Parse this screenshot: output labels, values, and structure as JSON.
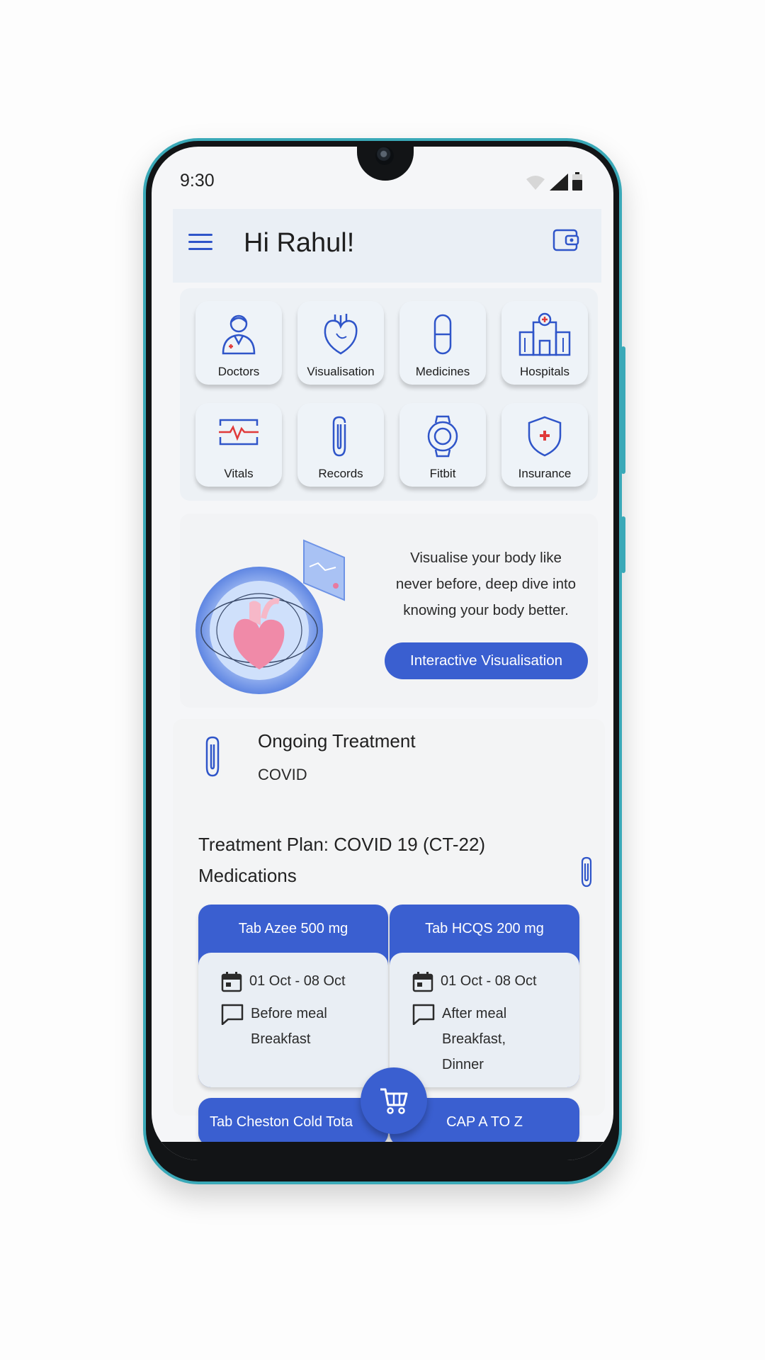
{
  "status_bar": {
    "time": "9:30"
  },
  "header": {
    "greeting": "Hi Rahul!"
  },
  "tiles": [
    {
      "label": "Doctors",
      "icon": "doctor-icon"
    },
    {
      "label": "Visualisation",
      "icon": "heart-anatomy-icon"
    },
    {
      "label": "Medicines",
      "icon": "pill-capsule-icon"
    },
    {
      "label": "Hospitals",
      "icon": "hospital-icon"
    },
    {
      "label": "Vitals",
      "icon": "vitals-monitor-icon"
    },
    {
      "label": "Records",
      "icon": "paperclip-icon"
    },
    {
      "label": "Fitbit",
      "icon": "smartwatch-icon"
    },
    {
      "label": "Insurance",
      "icon": "shield-plus-icon"
    }
  ],
  "visualise": {
    "line1": "Visualise your body like",
    "line2": "never before, deep dive into",
    "line3": "knowing your body better.",
    "button": "Interactive Visualisation"
  },
  "treatment": {
    "title": "Ongoing Treatment",
    "condition": "COVID",
    "plan": "Treatment Plan: COVID 19 (CT-22)",
    "medications_label": "Medications"
  },
  "medications": [
    {
      "name": "Tab Azee 500 mg",
      "dates": "01 Oct - 08 Oct",
      "instr1": "Before meal",
      "instr2": "Breakfast",
      "instr3": ""
    },
    {
      "name": "Tab HCQS 200 mg",
      "dates": "01 Oct - 08 Oct",
      "instr1": "After meal",
      "instr2": "Breakfast,",
      "instr3": "Dinner"
    },
    {
      "name": "Tab Cheston Cold Tota"
    },
    {
      "name": "CAP A TO Z"
    }
  ],
  "colors": {
    "primary": "#3a5fd0",
    "accent_red": "#e03a3a",
    "bezel": "#3aa9b8"
  }
}
